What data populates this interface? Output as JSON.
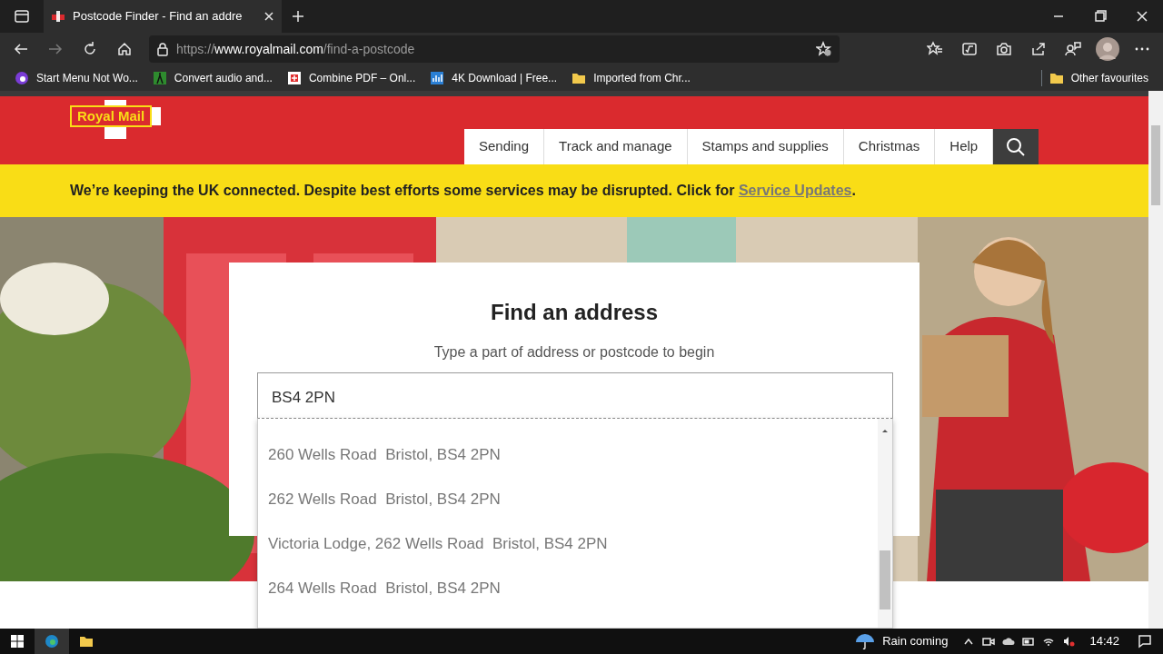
{
  "browser": {
    "tabs": [
      {
        "title": "Postcode Finder - Find an addre",
        "selected": true
      }
    ],
    "address": {
      "scheme": "https://",
      "host": "www.royalmail.com",
      "path": "/find-a-postcode"
    },
    "bookmarks": [
      {
        "label": "Start Menu Not Wo...",
        "kind": "app"
      },
      {
        "label": "Convert audio and...",
        "kind": "audio"
      },
      {
        "label": "Combine PDF – Onl...",
        "kind": "pdf"
      },
      {
        "label": "4K Download | Free...",
        "kind": "chart"
      },
      {
        "label": "Imported from Chr...",
        "kind": "folder"
      }
    ],
    "other_favourites": "Other favourites"
  },
  "page": {
    "logo": "Royal Mail",
    "nav": [
      {
        "label": "Sending",
        "selected": false
      },
      {
        "label": "Track and manage",
        "selected": false
      },
      {
        "label": "Stamps and supplies",
        "selected": false
      },
      {
        "label": "Christmas",
        "selected": false
      },
      {
        "label": "Help",
        "selected": false
      }
    ],
    "banner": {
      "text": "We’re keeping the UK connected. Despite best efforts some services may be disrupted. Click for",
      "link": "Service Updates",
      "end": "."
    },
    "finder": {
      "title": "Find an address",
      "subtitle": "Type a part of address or postcode to begin",
      "value": "BS4 2PN",
      "suggestions": [
        "260 Wells Road  Bristol, BS4 2PN",
        "262 Wells Road  Bristol, BS4 2PN",
        "Victoria Lodge, 262 Wells Road  Bristol, BS4 2PN",
        "264 Wells Road  Bristol, BS4 2PN"
      ]
    }
  },
  "taskbar": {
    "weather": "Rain coming",
    "time": "14:42"
  }
}
